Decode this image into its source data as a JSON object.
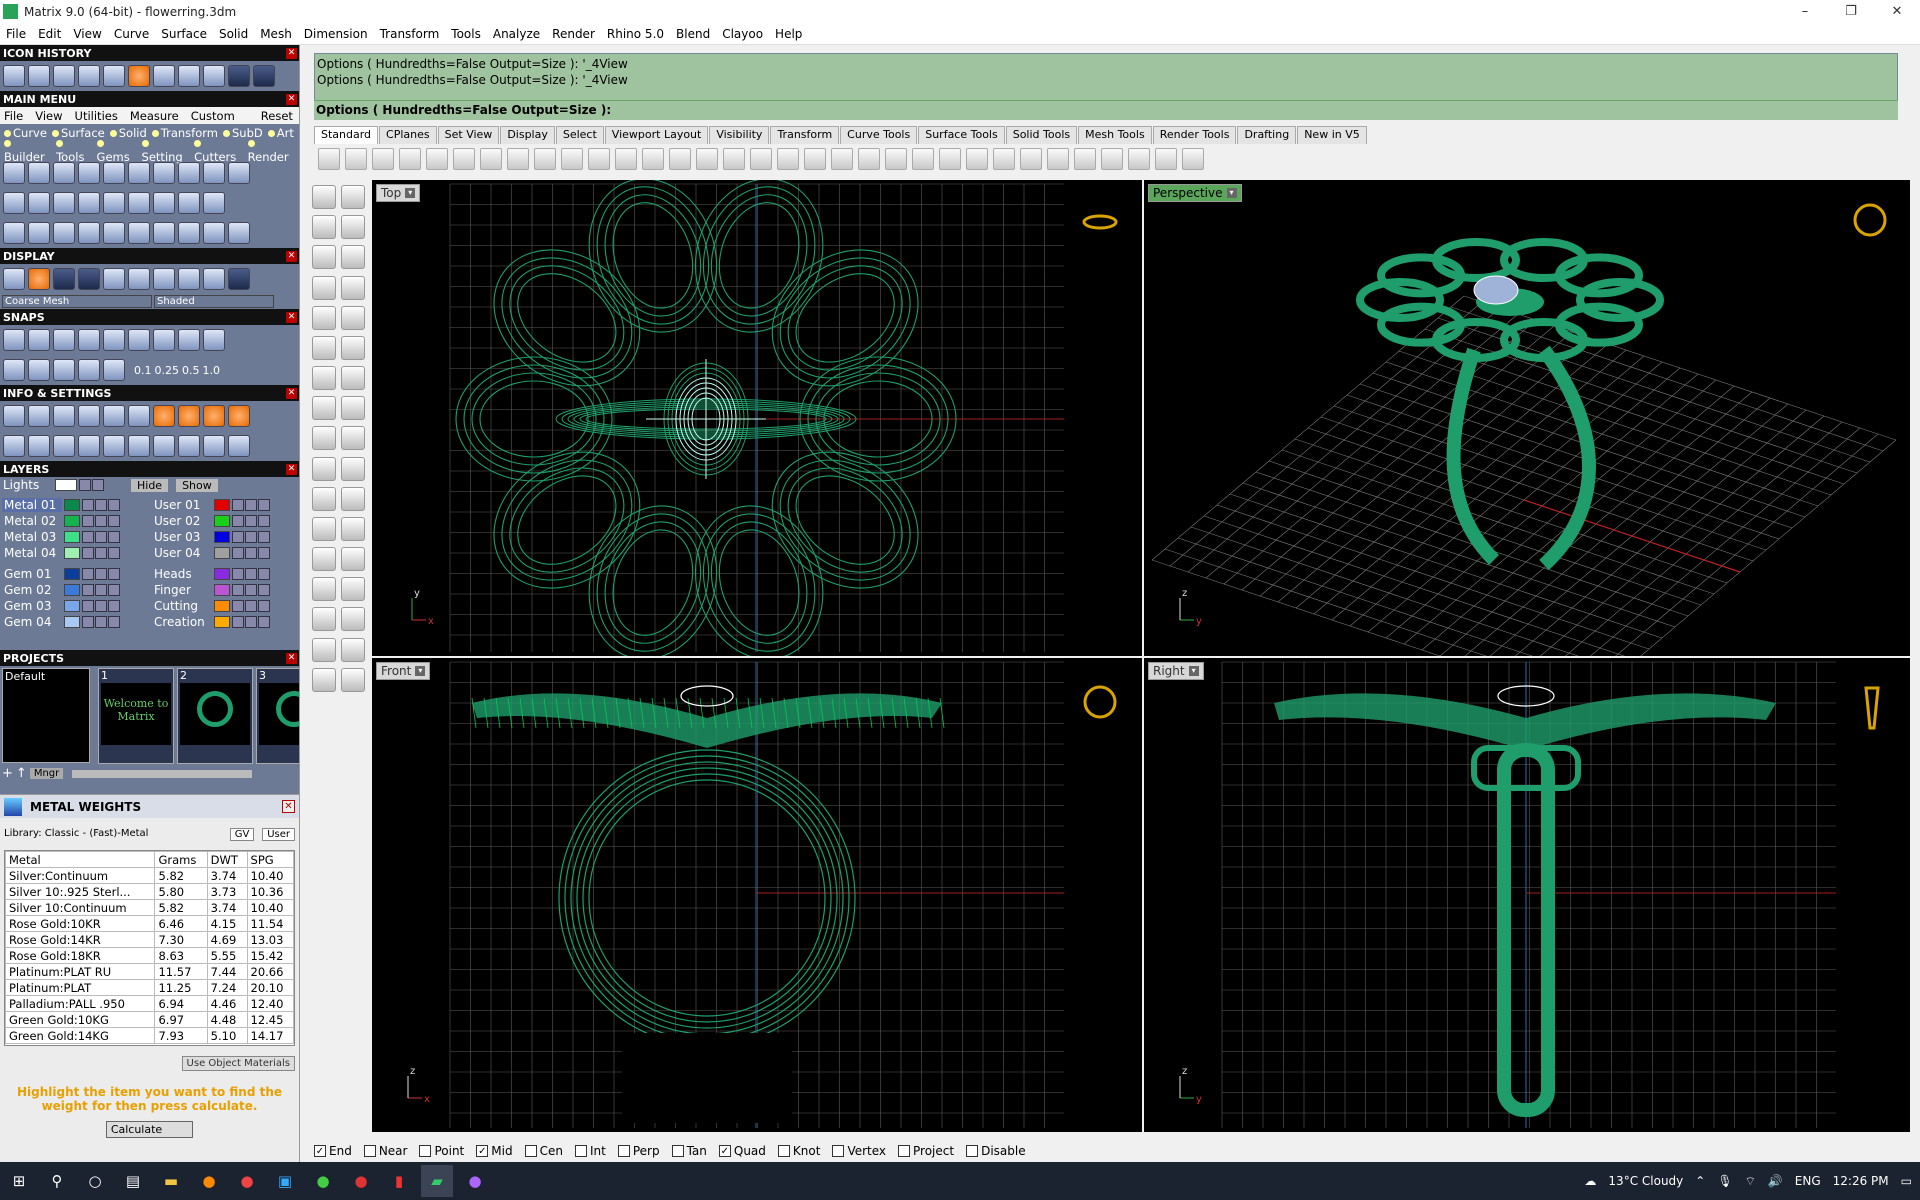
{
  "window": {
    "title": "Matrix 9.0 (64-bit) - flowerring.3dm",
    "min": "–",
    "max": "❐",
    "close": "✕"
  },
  "menu": [
    "File",
    "Edit",
    "View",
    "Curve",
    "Surface",
    "Solid",
    "Mesh",
    "Dimension",
    "Transform",
    "Tools",
    "Analyze",
    "Render",
    "Rhino 5.0",
    "Blend",
    "Clayoo",
    "Help"
  ],
  "left": {
    "icon_history": "ICON HISTORY",
    "main_menu": "MAIN MENU",
    "main_menu_items": [
      "File",
      "View",
      "Utilities",
      "Measure",
      "Custom",
      "Reset"
    ],
    "main_menu_row2": [
      "Curve",
      "Surface",
      "Solid",
      "Transform",
      "SubD",
      "Art"
    ],
    "main_menu_row3": [
      "Builder",
      "Tools",
      "Gems",
      "Setting",
      "Cutters",
      "Render"
    ],
    "display": "DISPLAY",
    "display_mesh": "Coarse Mesh",
    "display_shade": "Shaded",
    "snaps": "SNAPS",
    "snap_values": [
      "0.1",
      "0.25",
      "0.5",
      "1.0"
    ],
    "info": "INFO & SETTINGS",
    "layers": "LAYERS",
    "lights": "Lights",
    "hide": "Hide",
    "show": "Show",
    "layers_left": [
      {
        "name": "Metal 01",
        "color": "#0a8a4a",
        "sel": true
      },
      {
        "name": "Metal 02",
        "color": "#13b34f"
      },
      {
        "name": "Metal 03",
        "color": "#3fe08a"
      },
      {
        "name": "Metal 04",
        "color": "#9ef0b0"
      },
      {
        "name": "Gem 01",
        "color": "#0b3e9a"
      },
      {
        "name": "Gem 02",
        "color": "#3d79d8"
      },
      {
        "name": "Gem 03",
        "color": "#7aa7ea"
      },
      {
        "name": "Gem 04",
        "color": "#a9c8f3"
      }
    ],
    "layers_right": [
      {
        "name": "User 01",
        "color": "#e00000"
      },
      {
        "name": "User 02",
        "color": "#18d018"
      },
      {
        "name": "User 03",
        "color": "#0000e0"
      },
      {
        "name": "User 04",
        "color": "#a0a0a0"
      },
      {
        "name": "Heads",
        "color": "#8a2be2"
      },
      {
        "name": "Finger",
        "color": "#ba55d3"
      },
      {
        "name": "Cutting",
        "color": "#ff8c00"
      },
      {
        "name": "Creation",
        "color": "#ffaa00"
      }
    ],
    "projects": "PROJECTS",
    "project_default": "Default",
    "project_thumbs": [
      {
        "num": "1",
        "label": "Welcome to Matrix"
      },
      {
        "num": "2",
        "label": ""
      },
      {
        "num": "3",
        "label": ""
      }
    ],
    "mngr": "Mngr",
    "metal_weights": "METAL WEIGHTS",
    "library": "Library: Classic - (Fast)-Metal",
    "gv": "GV",
    "user": "User",
    "mw_headers": [
      "Metal",
      "Grams",
      "DWT",
      "SPG"
    ],
    "mw_rows": [
      [
        "Silver:Continuum",
        "5.82",
        "3.74",
        "10.40"
      ],
      [
        "Silver 10:.925 Sterl...",
        "5.80",
        "3.73",
        "10.36"
      ],
      [
        "Silver 10:Continuum",
        "5.82",
        "3.74",
        "10.40"
      ],
      [
        "Rose Gold:10KR",
        "6.46",
        "4.15",
        "11.54"
      ],
      [
        "Rose Gold:14KR",
        "7.30",
        "4.69",
        "13.03"
      ],
      [
        "Rose Gold:18KR",
        "8.63",
        "5.55",
        "15.42"
      ],
      [
        "Platinum:PLAT RU",
        "11.57",
        "7.44",
        "20.66"
      ],
      [
        "Platinum:PLAT",
        "11.25",
        "7.24",
        "20.10"
      ],
      [
        "Palladium:PALL .950",
        "6.94",
        "4.46",
        "12.40"
      ],
      [
        "Green Gold:10KG",
        "6.97",
        "4.48",
        "12.45"
      ],
      [
        "Green Gold:14KG",
        "7.93",
        "5.10",
        "14.17"
      ]
    ],
    "use_obj": "Use Object Materials",
    "hint": "Highlight the item you want to find the weight for then press calculate.",
    "calc": "Calculate"
  },
  "command": {
    "line1": "Options ( Hundredths=False  Output=Size ): '_4View",
    "line2": "Options ( Hundredths=False  Output=Size ): '_4View",
    "prompt": "Options ( Hundredths=False  Output=Size ):"
  },
  "tabs": [
    "Standard",
    "CPlanes",
    "Set View",
    "Display",
    "Select",
    "Viewport Layout",
    "Visibility",
    "Transform",
    "Curve Tools",
    "Surface Tools",
    "Solid Tools",
    "Mesh Tools",
    "Render Tools",
    "Drafting",
    "New in V5"
  ],
  "viewports": {
    "top": "Top",
    "perspective": "Perspective",
    "front": "Front",
    "right": "Right"
  },
  "axes": {
    "x": "x",
    "y": "y",
    "z": "z"
  },
  "snaps_bar": [
    {
      "label": "End",
      "on": true
    },
    {
      "label": "Near",
      "on": false
    },
    {
      "label": "Point",
      "on": false
    },
    {
      "label": "Mid",
      "on": true
    },
    {
      "label": "Cen",
      "on": false
    },
    {
      "label": "Int",
      "on": false
    },
    {
      "label": "Perp",
      "on": false
    },
    {
      "label": "Tan",
      "on": false
    },
    {
      "label": "Quad",
      "on": true
    },
    {
      "label": "Knot",
      "on": false
    },
    {
      "label": "Vertex",
      "on": false
    },
    {
      "label": "Project",
      "on": false
    },
    {
      "label": "Disable",
      "on": false
    }
  ],
  "tray": {
    "weather": "13°C  Cloudy",
    "lang": "ENG",
    "time": "12:26 PM"
  },
  "colors": {
    "wire": "#1f9e6b",
    "grid": "#5a5a5a",
    "viewport_bg": "#000000"
  }
}
